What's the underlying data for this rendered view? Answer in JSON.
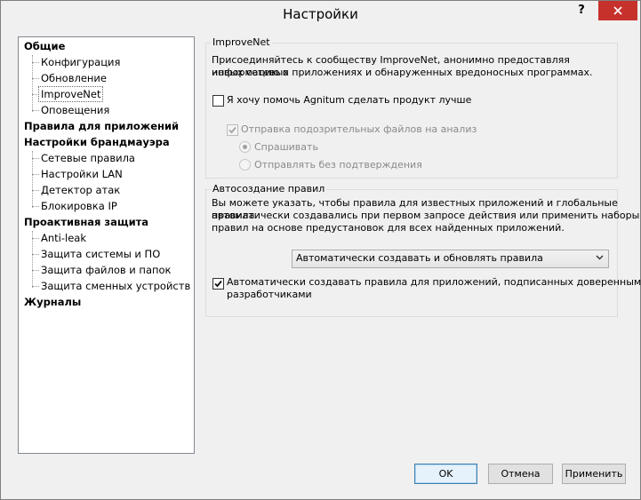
{
  "window": {
    "title": "Настройки",
    "help_glyph": "?",
    "close_icon": "close-icon"
  },
  "tree": {
    "items": [
      {
        "label": "Общие",
        "level": 0
      },
      {
        "label": "Конфигурация",
        "level": 1
      },
      {
        "label": "Обновление",
        "level": 1
      },
      {
        "label": "ImproveNet",
        "level": 1,
        "selected": true
      },
      {
        "label": "Оповещения",
        "level": 1
      },
      {
        "label": "Правила для приложений",
        "level": 0
      },
      {
        "label": "Настройки брандмауэра",
        "level": 0
      },
      {
        "label": "Сетевые правила",
        "level": 1
      },
      {
        "label": "Настройки LAN",
        "level": 1
      },
      {
        "label": "Детектор атак",
        "level": 1
      },
      {
        "label": "Блокировка IP",
        "level": 1
      },
      {
        "label": "Проактивная защита",
        "level": 0
      },
      {
        "label": "Anti-leak",
        "level": 1
      },
      {
        "label": "Защита системы и ПО",
        "level": 1
      },
      {
        "label": "Защита файлов и папок",
        "level": 1
      },
      {
        "label": "Защита сменных устройств",
        "level": 1
      },
      {
        "label": "Журналы",
        "level": 0
      }
    ]
  },
  "improvenet": {
    "legend": "ImproveNet",
    "description_line1": "Присоединяйтесь к сообществу ImproveNet, анонимно предоставляя информацию о",
    "description_line2": "новых сетевых приложениях и обнаруженных вредоносных программах.",
    "help_checkbox": {
      "label": "Я хочу помочь Agnitum сделать продукт лучше",
      "checked": false
    },
    "send_checkbox": {
      "label": "Отправка подозрительных файлов на анализ",
      "checked": true,
      "disabled": true
    },
    "radio_ask": {
      "label": "Спрашивать",
      "selected": true,
      "disabled": true
    },
    "radio_noconfirm": {
      "label": "Отправлять без подтверждения",
      "selected": false,
      "disabled": true
    }
  },
  "autorules": {
    "legend": "Автосоздание правил",
    "description_line1": "Вы можете указать, чтобы правила для известных приложений и глобальные правила",
    "description_line2": "автоматически создавались при первом запросе действия или применить наборы",
    "description_line3": "правил на основе предустановок для всех найденных приложений.",
    "mode_select": {
      "value": "Автоматически создавать и обновлять правила"
    },
    "trusted_checkbox": {
      "label_line1": "Автоматически создавать правила для приложений, подписанных доверенными",
      "label_line2": "разработчиками",
      "checked": true
    }
  },
  "buttons": {
    "ok": "OK",
    "cancel": "Отмена",
    "apply": "Применить"
  }
}
